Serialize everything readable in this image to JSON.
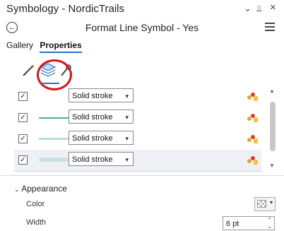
{
  "pane": {
    "title": "Symbology - NordicTrails",
    "controls": {
      "dropdown": "⌄",
      "pin": "⫫",
      "close": "×"
    },
    "subtitle": "Format Line Symbol - Yes"
  },
  "tabs": [
    {
      "label": "Gallery",
      "active": false
    },
    {
      "label": "Properties",
      "active": true
    }
  ],
  "icon_tabs": [
    {
      "name": "symbol-icon",
      "active": false
    },
    {
      "name": "layers-icon",
      "active": true,
      "highlighted": true
    },
    {
      "name": "structure-wrench-icon",
      "active": false
    }
  ],
  "layers": [
    {
      "checked": true,
      "type": "Solid stroke",
      "line_color": "#3b8c8a",
      "line_width": 0,
      "selected": false
    },
    {
      "checked": true,
      "type": "Solid stroke",
      "line_color": "#58a6a0",
      "line_width": 2,
      "selected": false
    },
    {
      "checked": true,
      "type": "Solid stroke",
      "line_color": "#b7dcd9",
      "line_width": 3,
      "selected": false
    },
    {
      "checked": true,
      "type": "Solid stroke",
      "line_color": "#c9e3e0",
      "line_width": 6,
      "selected": true
    }
  ],
  "appearance": {
    "header": "Appearance",
    "color_label": "Color",
    "width_label": "Width",
    "width_value": "6 pt"
  },
  "colors": {
    "accent": "#2f6fbf",
    "highlight_ring": "#d9141c"
  }
}
